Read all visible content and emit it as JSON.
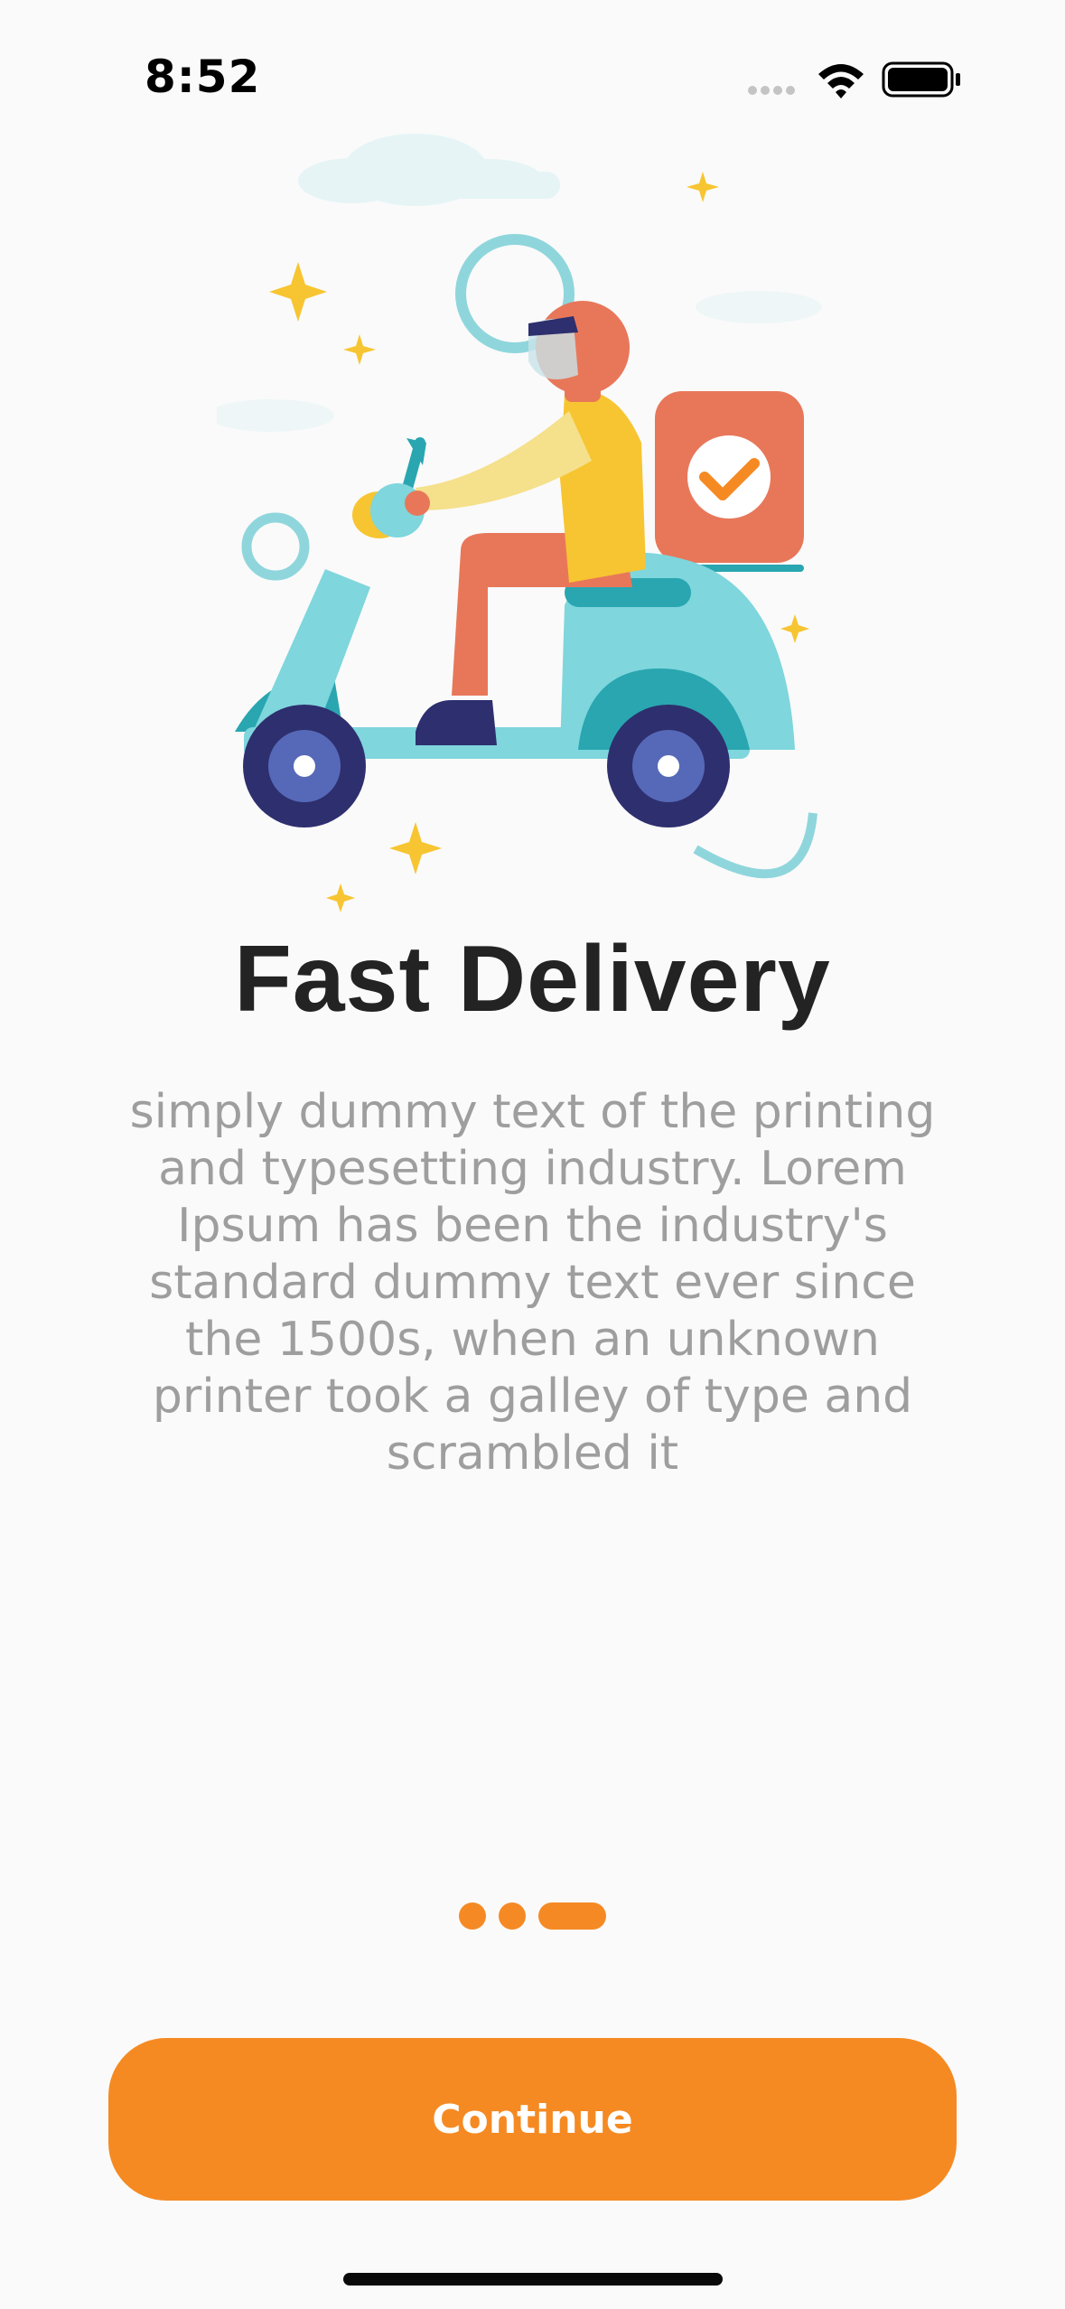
{
  "status_bar": {
    "time": "8:52",
    "icons": [
      "signal-dots-icon",
      "wifi-icon",
      "battery-icon"
    ]
  },
  "hero": {
    "illustration": "delivery-scooter-illustration"
  },
  "onboarding": {
    "title": "Fast Delivery",
    "description": "simply dummy text of the printing and typesetting industry. Lorem Ipsum has been the industry's standard dummy text ever since the 1500s, when an unknown printer took a galley of type and scrambled it",
    "page_count": 3,
    "active_page": 3
  },
  "actions": {
    "continue_label": "Continue"
  },
  "colors": {
    "accent": "#f58a23",
    "title": "#232323",
    "body_text": "#9e9e9e",
    "background": "#fafafa"
  }
}
